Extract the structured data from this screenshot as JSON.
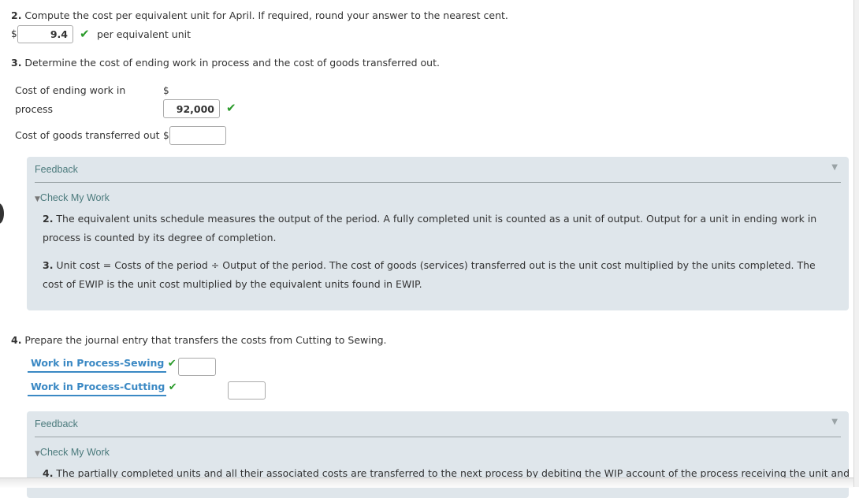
{
  "q2": {
    "number": "2.",
    "text": " Compute the cost per equivalent unit for April. If required, round your answer to the nearest cent.",
    "currency": "$",
    "value": "9.4",
    "unit_label": "per equivalent unit",
    "status": "correct"
  },
  "q3": {
    "number": "3.",
    "text": " Determine the cost of ending work in process and the cost of goods transferred out.",
    "rows": [
      {
        "label_line1": "Cost of ending work in",
        "label_line2": "process",
        "currency": "$",
        "value": "92,000",
        "status": "correct"
      },
      {
        "label": "Cost of goods transferred out",
        "currency": "$",
        "value": ""
      }
    ]
  },
  "feedback1": {
    "title": "Feedback",
    "check_my_work": "Check My Work",
    "items": [
      {
        "number": "2.",
        "text": " The equivalent units schedule measures the output of the period. A fully completed unit is counted as a unit of output. Output for a unit in ending work in process is counted by its degree of completion."
      },
      {
        "number": "3.",
        "text": " Unit cost = Costs of the period ÷ Output of the period. The cost of goods (services) transferred out is the unit cost multiplied by the units completed. The cost of EWIP is the unit cost multiplied by the equivalent units found in EWIP."
      }
    ]
  },
  "q4": {
    "number": "4.",
    "text": " Prepare the journal entry that transfers the costs from Cutting to Sewing.",
    "entries": [
      {
        "account": "Work in Process-Sewing",
        "status": "correct",
        "debit": ""
      },
      {
        "account": "Work in Process-Cutting",
        "status": "correct",
        "credit": ""
      }
    ]
  },
  "feedback2": {
    "title": "Feedback",
    "check_my_work": "Check My Work",
    "items": [
      {
        "number": "4.",
        "text": " The partially completed units and all their associated costs are transferred to the next process by debiting the WIP account of the process receiving the unit and"
      }
    ]
  },
  "icons": {
    "check": "✔",
    "collapse": "▼",
    "expand_small": "▼"
  },
  "colors": {
    "check_green": "#2a9a2a",
    "link_blue": "#3b89c4",
    "feedback_bg": "#dfe6eb",
    "feedback_title": "#4b7a7c"
  }
}
